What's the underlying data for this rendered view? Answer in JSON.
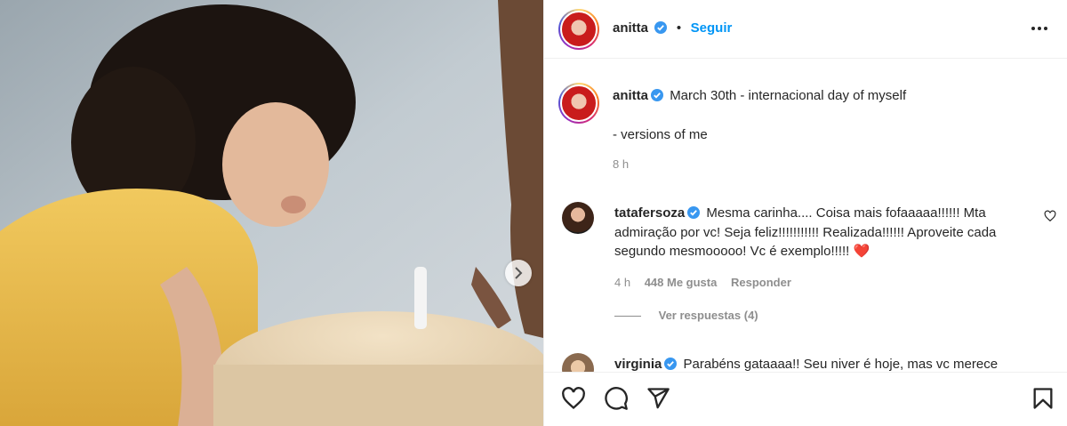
{
  "post": {
    "author": "anitta",
    "follow_label": "Seguir",
    "dot": "•",
    "caption_line1": "March 30th - internacional day of myself",
    "caption_line2": "- versions of me",
    "caption_time": "8 h"
  },
  "comments": [
    {
      "user": "tatafersoza",
      "text_line1": "Mesma carinha.... Coisa mais fofaaaaa!!!!!! Mta",
      "text_line2": "admiração por vc! Seja feliz!!!!!!!!!!! Realizada!!!!!! Aproveite cada",
      "text_line3": "segundo mesmooooo! Vc é exemplo!!!!!",
      "emoji": "❤️",
      "time": "4 h",
      "likes": "448 Me gusta",
      "reply_label": "Responder",
      "view_replies": "Ver respuestas (4)"
    },
    {
      "user": "virginia",
      "text_line1": "Parabéns gataaaa!! Seu niver é hoje, mas vc merece"
    }
  ],
  "icons": {
    "verified": "verified-badge-icon",
    "more": "more-options-icon",
    "like": "heart-icon",
    "comment": "comment-icon",
    "share": "share-icon",
    "save": "bookmark-icon",
    "next": "chevron-right-icon"
  },
  "colors": {
    "link": "#0095f6",
    "verified": "#3897f0",
    "heart_emoji": "#e0245e",
    "muted": "#8e8e8e"
  }
}
